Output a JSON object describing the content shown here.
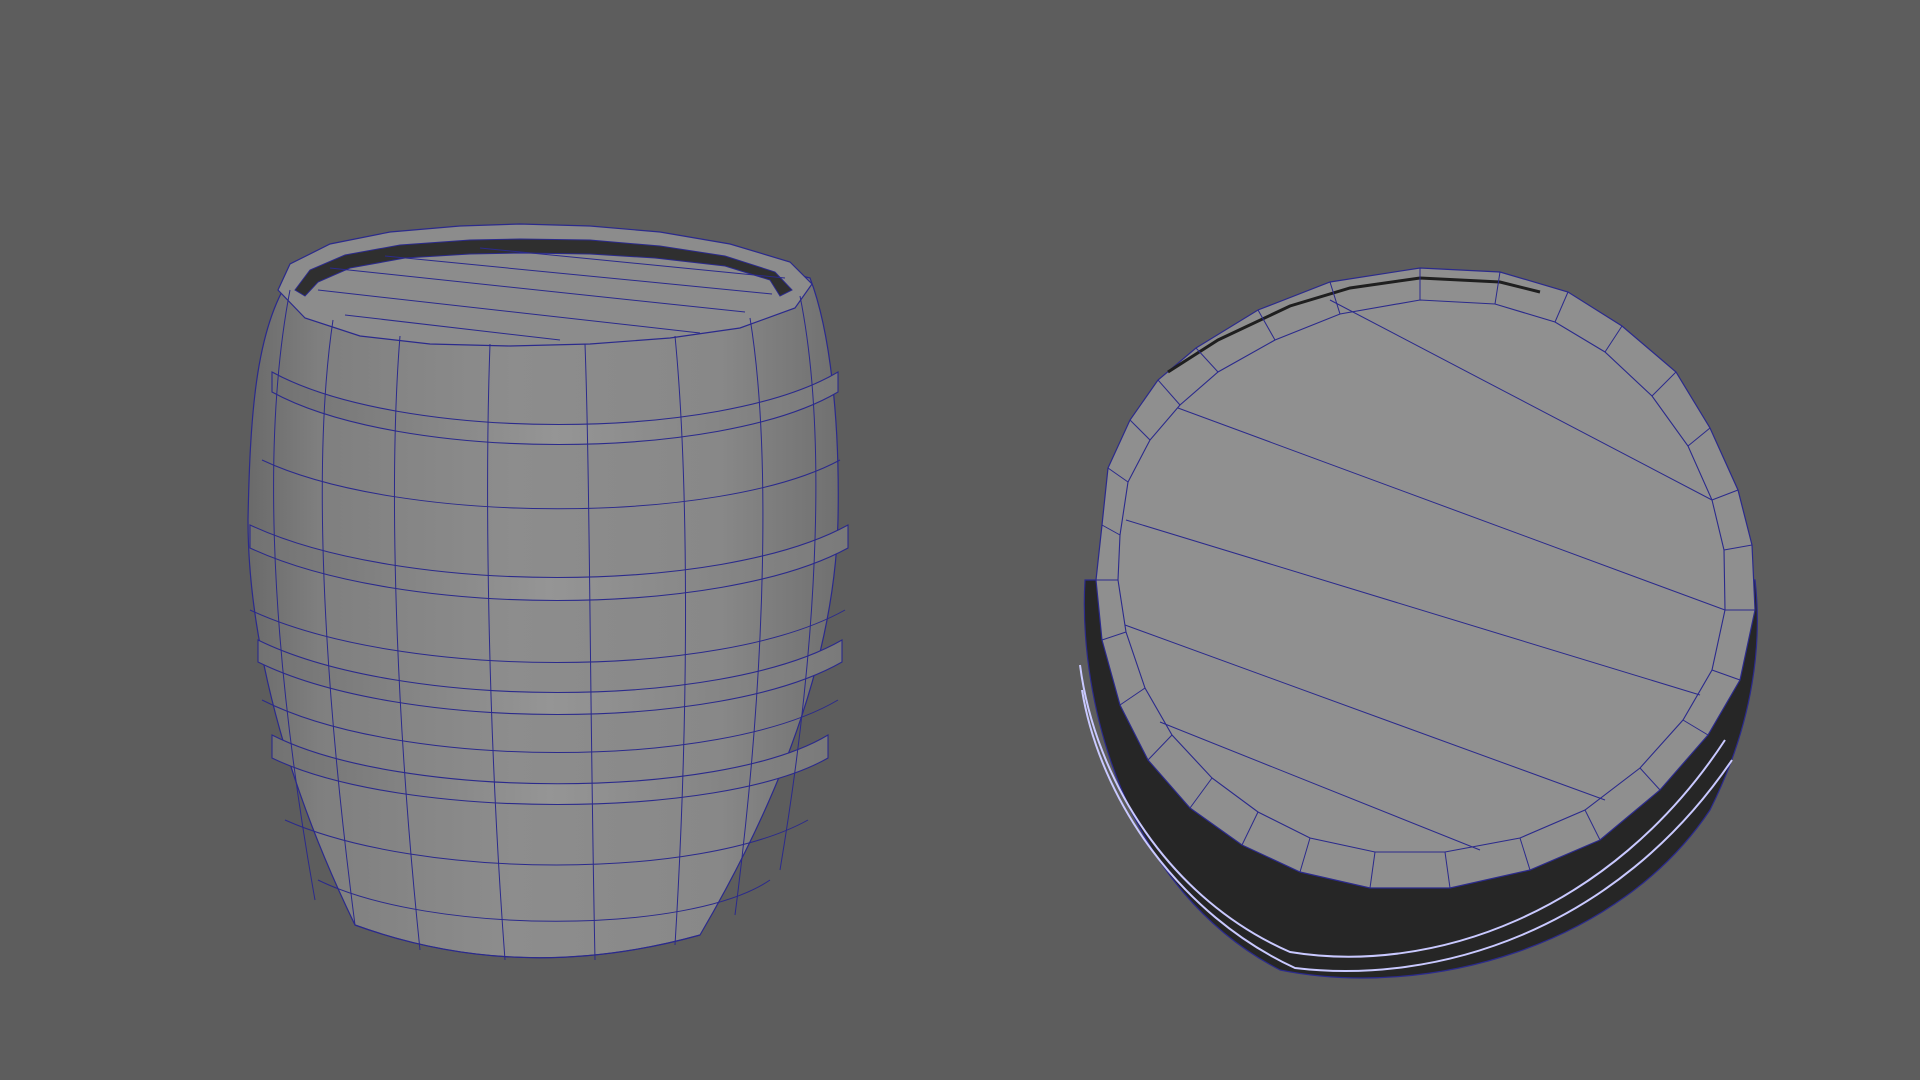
{
  "viewport": {
    "background_color": "#5d5d5d",
    "shading_mode": "wireframe-on-shaded",
    "wireframe_color": "#2b2a8c",
    "objects": [
      {
        "name": "barrel-side-view",
        "view": "side",
        "shade_color": "#8a8a8a"
      },
      {
        "name": "barrel-top-view",
        "view": "top",
        "shade_color": "#8f8f8f",
        "rim_dark_color": "#262626"
      }
    ]
  }
}
